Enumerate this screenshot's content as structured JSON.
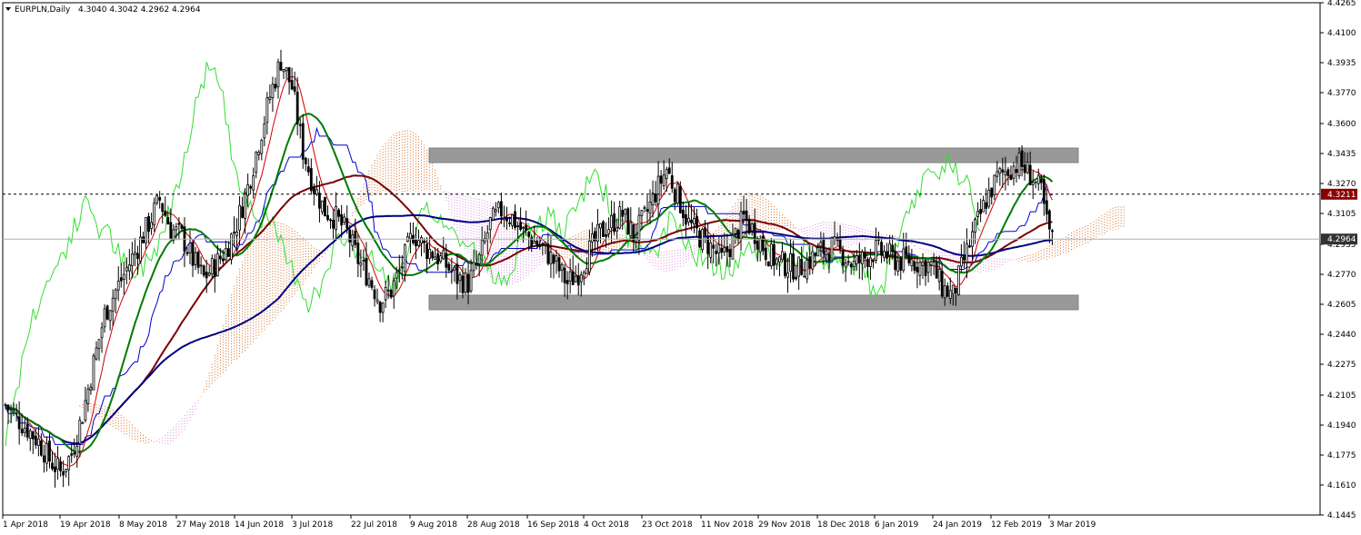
{
  "header": {
    "symbol": "EURPLN,Daily",
    "ohlc": "4.3040 4.3042 4.2962 4.2964"
  },
  "colors": {
    "candle": "#000000",
    "ma_fast": "#d00000",
    "ma_mid": "#007a00",
    "ma_slow": "#7a0000",
    "ma_long": "#000080",
    "kijun": "#0000cc",
    "chikou": "#33dd33",
    "cloud_bull": "#d2691e",
    "cloud_bear": "#dd88dd",
    "zone": "#999999",
    "resistance_tag": "#8b0000",
    "price_tag": "#333333"
  },
  "chart_data": {
    "type": "candlestick",
    "title": "EURPLN,Daily",
    "y_ticks": [
      "4.4265",
      "4.4100",
      "4.3935",
      "4.3770",
      "4.3600",
      "4.3435",
      "4.3270",
      "4.3105",
      "4.2935",
      "4.2770",
      "4.2605",
      "4.2440",
      "4.2275",
      "4.2105",
      "4.1940",
      "4.1775",
      "4.1610",
      "4.1445"
    ],
    "ylim": [
      4.1445,
      4.4265
    ],
    "x_ticks": [
      "1 Apr 2018",
      "19 Apr 2018",
      "8 May 2018",
      "27 May 2018",
      "14 Jun 2018",
      "3 Jul 2018",
      "22 Jul 2018",
      "9 Aug 2018",
      "28 Aug 2018",
      "16 Sep 2018",
      "4 Oct 2018",
      "23 Oct 2018",
      "11 Nov 2018",
      "29 Nov 2018",
      "18 Dec 2018",
      "6 Jan 2019",
      "24 Jan 2019",
      "12 Feb 2019",
      "3 Mar 2019"
    ],
    "last_price": "4.2964",
    "resistance_line": "4.3211",
    "zones": [
      {
        "name": "upper range zone",
        "from": 4.338,
        "to": 4.346
      },
      {
        "name": "lower range zone",
        "from": 4.258,
        "to": 4.266
      }
    ],
    "series": [
      {
        "name": "price",
        "points": [
          [
            0,
            4.205
          ],
          [
            4,
            4.198
          ],
          [
            8,
            4.192
          ],
          [
            12,
            4.185
          ],
          [
            16,
            4.175
          ],
          [
            20,
            4.168
          ],
          [
            24,
            4.178
          ],
          [
            28,
            4.2
          ],
          [
            32,
            4.228
          ],
          [
            36,
            4.255
          ],
          [
            40,
            4.268
          ],
          [
            44,
            4.28
          ],
          [
            48,
            4.292
          ],
          [
            52,
            4.305
          ],
          [
            56,
            4.318
          ],
          [
            60,
            4.302
          ],
          [
            64,
            4.298
          ],
          [
            68,
            4.285
          ],
          [
            72,
            4.275
          ],
          [
            76,
            4.282
          ],
          [
            80,
            4.29
          ],
          [
            84,
            4.305
          ],
          [
            88,
            4.325
          ],
          [
            92,
            4.35
          ],
          [
            96,
            4.375
          ],
          [
            100,
            4.395
          ],
          [
            104,
            4.38
          ],
          [
            108,
            4.345
          ],
          [
            112,
            4.325
          ],
          [
            116,
            4.312
          ],
          [
            120,
            4.308
          ],
          [
            124,
            4.3
          ],
          [
            128,
            4.285
          ],
          [
            132,
            4.275
          ],
          [
            136,
            4.262
          ],
          [
            140,
            4.268
          ],
          [
            144,
            4.282
          ],
          [
            148,
            4.3
          ],
          [
            152,
            4.292
          ],
          [
            156,
            4.288
          ],
          [
            160,
            4.282
          ],
          [
            164,
            4.275
          ],
          [
            168,
            4.272
          ],
          [
            172,
            4.285
          ],
          [
            176,
            4.305
          ],
          [
            180,
            4.312
          ],
          [
            184,
            4.308
          ],
          [
            188,
            4.3
          ],
          [
            192,
            4.295
          ],
          [
            196,
            4.29
          ],
          [
            200,
            4.282
          ],
          [
            204,
            4.272
          ],
          [
            208,
            4.278
          ],
          [
            212,
            4.29
          ],
          [
            216,
            4.3
          ],
          [
            220,
            4.305
          ],
          [
            224,
            4.31
          ],
          [
            228,
            4.298
          ],
          [
            232,
            4.308
          ],
          [
            236,
            4.322
          ],
          [
            240,
            4.335
          ],
          [
            244,
            4.32
          ],
          [
            248,
            4.305
          ],
          [
            252,
            4.298
          ],
          [
            256,
            4.292
          ],
          [
            260,
            4.285
          ],
          [
            264,
            4.295
          ],
          [
            268,
            4.308
          ],
          [
            272,
            4.3
          ],
          [
            276,
            4.29
          ],
          [
            280,
            4.284
          ],
          [
            284,
            4.282
          ],
          [
            288,
            4.28
          ],
          [
            292,
            4.285
          ],
          [
            296,
            4.29
          ],
          [
            300,
            4.292
          ],
          [
            304,
            4.288
          ],
          [
            308,
            4.282
          ],
          [
            312,
            4.286
          ],
          [
            316,
            4.29
          ],
          [
            320,
            4.288
          ],
          [
            324,
            4.284
          ],
          [
            328,
            4.285
          ],
          [
            332,
            4.283
          ],
          [
            336,
            4.282
          ],
          [
            340,
            4.27
          ],
          [
            344,
            4.265
          ],
          [
            348,
            4.285
          ],
          [
            352,
            4.302
          ],
          [
            356,
            4.318
          ],
          [
            360,
            4.33
          ],
          [
            364,
            4.335
          ],
          [
            368,
            4.338
          ],
          [
            372,
            4.332
          ],
          [
            376,
            4.322
          ],
          [
            378,
            4.305
          ],
          [
            380,
            4.296
          ]
        ]
      },
      {
        "name": "ma_fast",
        "color": "#d00000"
      },
      {
        "name": "ma_mid",
        "color": "#007a00"
      },
      {
        "name": "ma_slow",
        "color": "#7a0000"
      },
      {
        "name": "ma_long",
        "color": "#000080"
      }
    ]
  }
}
